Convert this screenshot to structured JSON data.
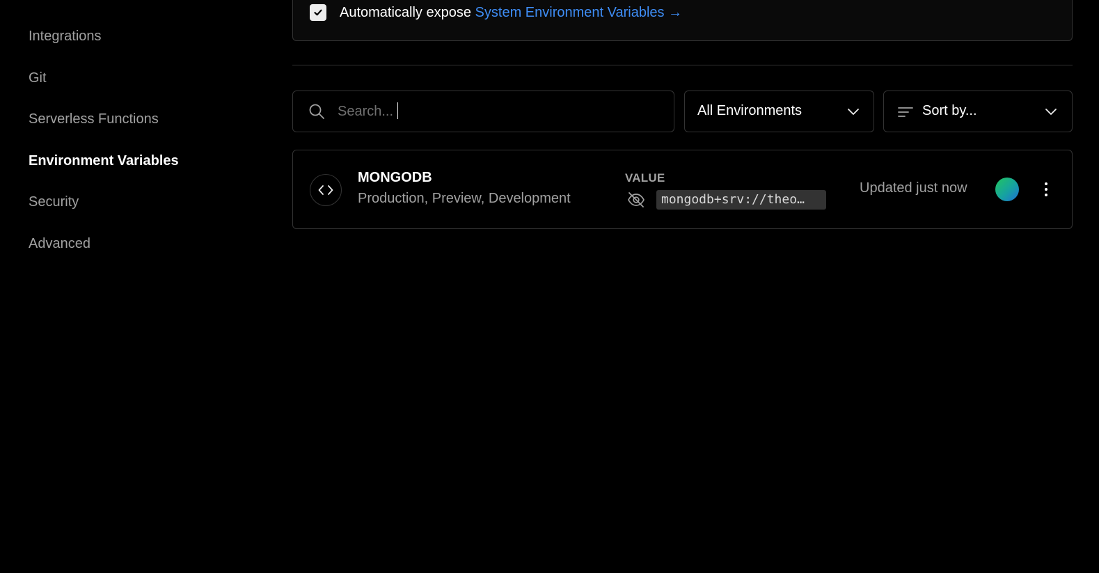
{
  "sidebar": {
    "items": [
      {
        "label": "Integrations",
        "active": false
      },
      {
        "label": "Git",
        "active": false
      },
      {
        "label": "Serverless Functions",
        "active": false
      },
      {
        "label": "Environment Variables",
        "active": true
      },
      {
        "label": "Security",
        "active": false
      },
      {
        "label": "Advanced",
        "active": false
      }
    ]
  },
  "system_vars": {
    "checked": true,
    "text": "Automatically expose",
    "link": "System Environment Variables →"
  },
  "filters": {
    "search_placeholder": "Search...",
    "environment_select": "All Environments",
    "sort_select": "Sort by..."
  },
  "variables": [
    {
      "name": "MONGODB",
      "environments": "Production, Preview, Development",
      "value_label": "VALUE",
      "value": "mongodb+srv://theo…",
      "updated": "Updated just now"
    }
  ],
  "colors": {
    "background": "#000000",
    "link": "#3e8df5",
    "border": "#333333",
    "muted_text": "#a1a1a1"
  }
}
